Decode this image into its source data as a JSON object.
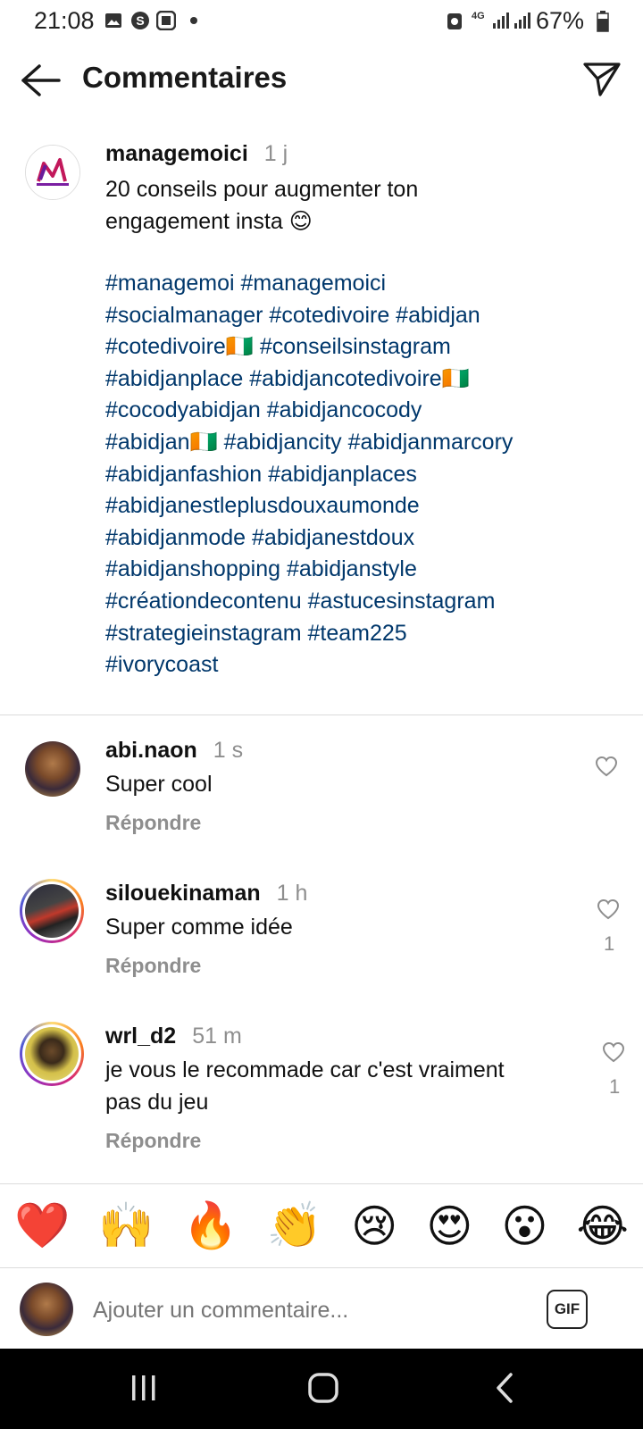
{
  "status_bar": {
    "time": "21:08",
    "battery": "67%",
    "network": "4G"
  },
  "header": {
    "title": "Commentaires"
  },
  "caption": {
    "username": "managemoici",
    "time": "1 j",
    "text": "20 conseils pour augmenter ton\nengagement insta 😊",
    "hashtag_lines": [
      "#managemoi #managemoici",
      "#socialmanager #cotedivoire #abidjan",
      "#cotedivoire🇨🇮 #conseilsinstagram",
      "#abidjanplace #abidjancotedivoire🇨🇮",
      "#cocodyabidjan #abidjancocody",
      "#abidjan🇨🇮 #abidjancity #abidjanmarcory",
      "#abidjanfashion #abidjanplaces",
      "#abidjanestleplusdouxaumonde",
      "#abidjanmode #abidjanestdoux",
      "#abidjanshopping #abidjanstyle",
      "#créationdecontenu #astucesinstagram",
      "#strategieinstagram #team225",
      "#ivorycoast"
    ]
  },
  "comments": [
    {
      "username": "abi.naon",
      "time": "1 s",
      "text": "Super cool",
      "reply_label": "Répondre",
      "likes": ""
    },
    {
      "username": "silouekinaman",
      "time": "1 h",
      "text": "Super comme idée",
      "reply_label": "Répondre",
      "likes": "1"
    },
    {
      "username": "wrl_d2",
      "time": "51 m",
      "text": "je vous le recommade car c'est vraiment\npas du jeu",
      "reply_label": "Répondre",
      "likes": "1"
    }
  ],
  "emoji_bar": [
    "❤️",
    "🙌",
    "🔥",
    "👏",
    "😢",
    "😍",
    "😮",
    "😂"
  ],
  "comment_input": {
    "placeholder": "Ajouter un commentaire...",
    "gif_label": "GIF"
  },
  "colors": {
    "hashtag": "#00376b",
    "secondary_text": "#8e8e8e",
    "divider": "#dbdbdb"
  }
}
